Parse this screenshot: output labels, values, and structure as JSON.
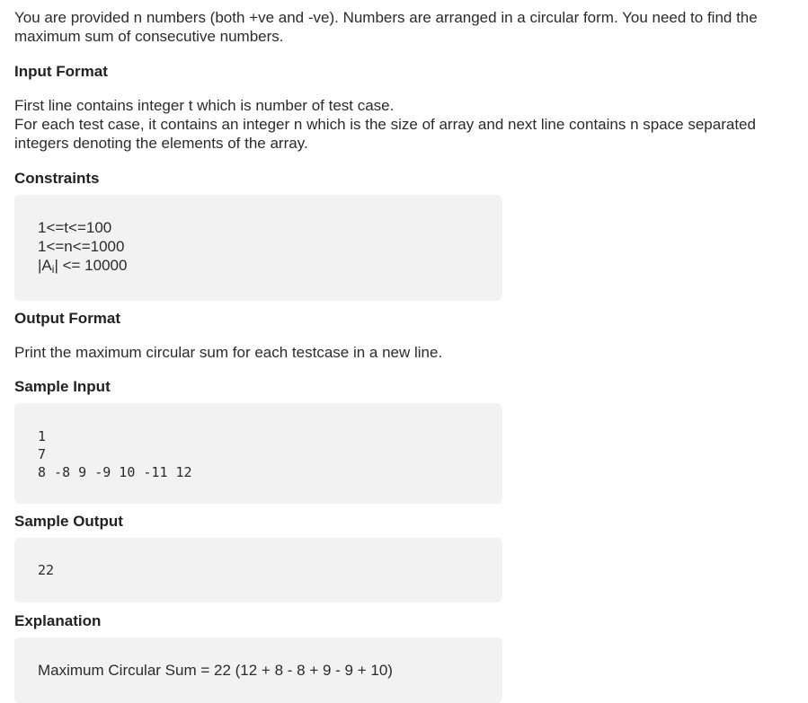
{
  "intro": {
    "line1": "You are provided n numbers (both +ve and -ve). Numbers are arranged in a circular form. You need to find the",
    "line2": "maximum sum of consecutive numbers."
  },
  "input_format": {
    "heading": "Input Format",
    "line1": "First line contains integer t which is number of test case.",
    "line2": "For each test case, it contains an integer n which is the size of array and next line contains n space separated",
    "line3": "integers denoting the elements of the array."
  },
  "constraints": {
    "heading": "Constraints",
    "line1": "1<=t<=100",
    "line2": "1<=n<=1000",
    "line3_prefix": "|A",
    "line3_sub": "i",
    "line3_suffix": "| <= 10000"
  },
  "output_format": {
    "heading": "Output Format",
    "text": "Print the maximum circular sum for each testcase in a new line."
  },
  "sample_input": {
    "heading": "Sample Input",
    "lines": [
      "1",
      "7",
      "8 -8 9 -9 10 -11 12"
    ]
  },
  "sample_output": {
    "heading": "Sample Output",
    "lines": [
      "22"
    ]
  },
  "explanation": {
    "heading": "Explanation",
    "text": "Maximum Circular Sum = 22 (12 + 8 - 8 + 9 - 9 + 10)"
  },
  "colors": {
    "text": "#2b2b2b",
    "box_background": "#f2f2f2"
  }
}
